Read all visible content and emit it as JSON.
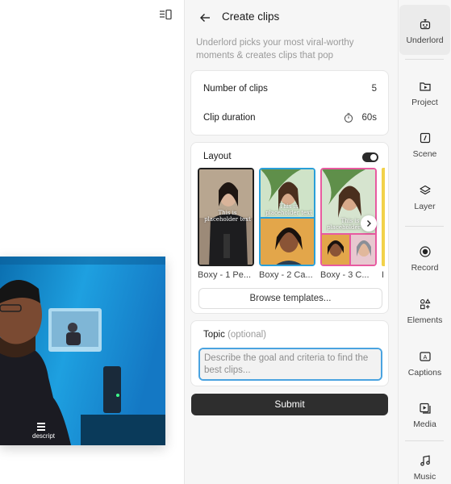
{
  "panel": {
    "title": "Create clips",
    "intro": "Underlord picks your most viral-worthy moments & creates clips that pop"
  },
  "settings": {
    "clips_label": "Number of clips",
    "clips_value": "5",
    "duration_label": "Clip duration",
    "duration_value": "60s"
  },
  "layout": {
    "label": "Layout",
    "toggle_on": true,
    "templates": [
      {
        "name": "Boxy - 1 Pe...",
        "placeholder": "This is placeholder text",
        "selected": true
      },
      {
        "name": "Boxy - 2 Ca...",
        "placeholder": "This is placeholder text",
        "accent": "#2a9fd8"
      },
      {
        "name": "Boxy - 3 C...",
        "placeholder": "This is placeholder text",
        "accent": "#e85aa0"
      }
    ],
    "browse_label": "Browse templates..."
  },
  "topic": {
    "label": "Topic",
    "optional": "(optional)",
    "placeholder": "Describe the goal and criteria to find the best clips..."
  },
  "submit_label": "Submit",
  "video": {
    "logo_text": "descript"
  },
  "nav": {
    "items": [
      {
        "label": "Underlord",
        "icon": "robot-icon",
        "active": true
      },
      {
        "label": "Project",
        "icon": "project-folder-icon"
      },
      {
        "label": "Scene",
        "icon": "scene-icon"
      },
      {
        "label": "Layer",
        "icon": "layers-icon"
      },
      {
        "label": "Record",
        "icon": "record-icon"
      },
      {
        "label": "Elements",
        "icon": "elements-icon"
      },
      {
        "label": "Captions",
        "icon": "captions-icon"
      },
      {
        "label": "Media",
        "icon": "media-icon"
      },
      {
        "label": "Music",
        "icon": "music-note-icon"
      }
    ]
  },
  "colors": {
    "accent_blue": "#4aa3e0",
    "submit_bg": "#2e2e2e",
    "panel_bg": "#f6f6f6"
  }
}
